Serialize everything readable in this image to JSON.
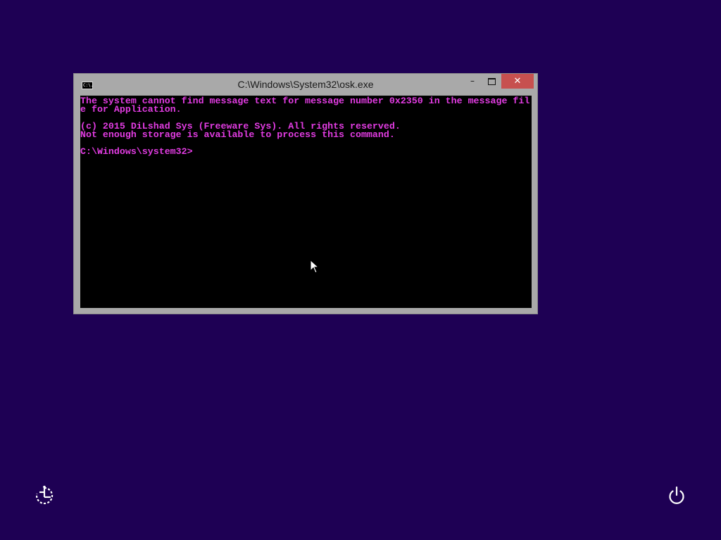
{
  "window": {
    "title": "C:\\Windows\\System32\\osk.exe",
    "icon_label": "C:\\.",
    "buttons": {
      "minimize": "–",
      "maximize_icon": "maximize-icon",
      "close": "✕"
    }
  },
  "console": {
    "lines": [
      "The system cannot find message text for message number 0x2350 in the message fil",
      "e for Application.",
      "",
      "(c) 2015 DiLshad Sys (Freeware Sys). All rights reserved.",
      "Not enough storage is available to process this command.",
      "",
      "C:\\Windows\\system32>"
    ],
    "text_color": "#e23ce2",
    "background": "#000000"
  },
  "desktop": {
    "background": "#1e0054",
    "icons": [
      "ease-of-access-icon",
      "power-icon"
    ]
  }
}
